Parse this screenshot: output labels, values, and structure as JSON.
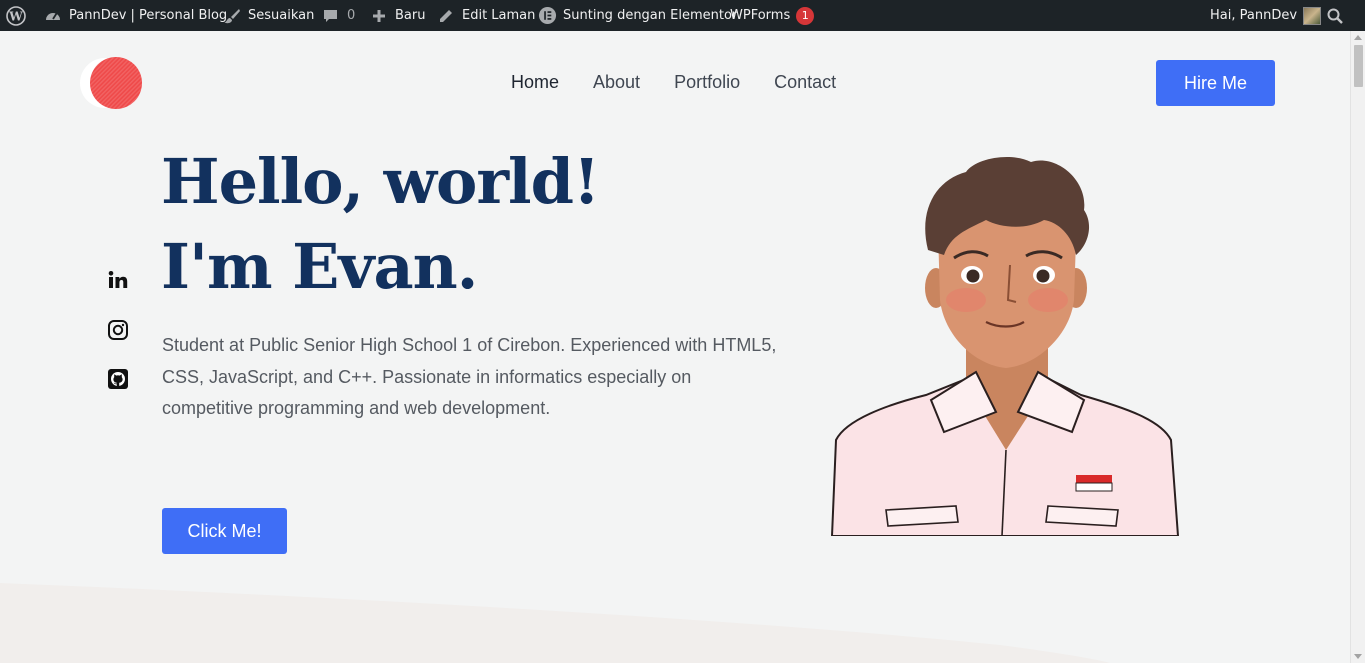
{
  "adminbar": {
    "wp_logo_icon": "wordpress-icon",
    "site_name": "PannDev | Personal Blog",
    "customize_label": "Sesuaikan",
    "comments_count": "0",
    "new_label": "Baru",
    "edit_page_label": "Edit Laman",
    "elementor_label": "Sunting dengan Elementor",
    "wpforms_label": "WPForms",
    "wpforms_badge": "1",
    "greeting": "Hai, PannDev"
  },
  "header": {
    "nav": [
      {
        "label": "Home"
      },
      {
        "label": "About"
      },
      {
        "label": "Portfolio"
      },
      {
        "label": "Contact"
      }
    ],
    "hire_button": "Hire Me"
  },
  "hero": {
    "title_line1": "Hello, world!",
    "title_line2": "I'm Evan.",
    "description": "Student at Public Senior High School 1 of Cirebon. Experienced with HTML5, CSS, JavaScript, and C++. Passionate in informatics especially on competitive programming and web development.",
    "cta_button": "Click Me!"
  },
  "socials": [
    {
      "icon": "linkedin-icon"
    },
    {
      "icon": "instagram-icon"
    },
    {
      "icon": "github-icon"
    }
  ],
  "colors": {
    "accent": "#3f6ef6",
    "title": "#12315e",
    "adminbar_bg": "#1d2327",
    "page_bg": "#f3f4f4"
  }
}
